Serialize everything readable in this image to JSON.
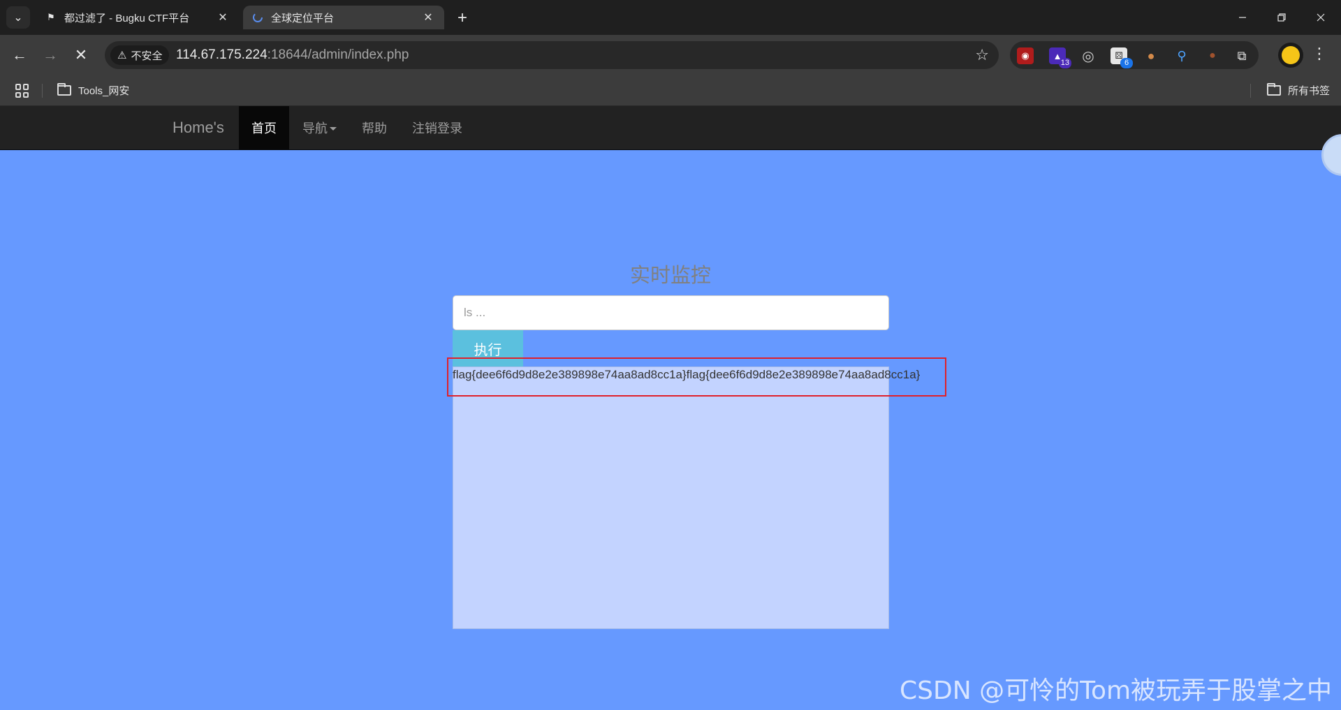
{
  "browser": {
    "tabs": [
      {
        "title": "都过滤了 - Bugku CTF平台",
        "favicon": "flag-icon",
        "active": false
      },
      {
        "title": "全球定位平台",
        "favicon": "loading-spinner-icon",
        "active": true
      }
    ],
    "address": {
      "security_label": "不安全",
      "url_host": "114.67.175.224",
      "url_rest": ":18644/admin/index.php"
    },
    "extensions": [
      {
        "name": "red-extension-icon",
        "badge": ""
      },
      {
        "name": "purple-hat-extension-icon",
        "badge": "13"
      },
      {
        "name": "circle-extension-icon",
        "badge": ""
      },
      {
        "name": "dice-extension-icon",
        "badge": "6"
      },
      {
        "name": "cookie-extension-icon",
        "badge": ""
      },
      {
        "name": "pin-extension-icon",
        "badge": ""
      },
      {
        "name": "bear-extension-icon",
        "badge": ""
      },
      {
        "name": "puzzle-extensions-icon",
        "badge": ""
      }
    ],
    "bookmarks": {
      "folder": "Tools_网安",
      "all_bookmarks": "所有书签"
    }
  },
  "site": {
    "brand": "Home's",
    "nav": [
      {
        "label": "首页",
        "active": true
      },
      {
        "label": "导航",
        "dropdown": true
      },
      {
        "label": "帮助"
      },
      {
        "label": "注销登录"
      }
    ],
    "panel": {
      "title": "实时监控",
      "input_placeholder": "ls ...",
      "input_value": "",
      "execute_label": "执行",
      "output": "flag{dee6f6d9d8e2e389898e74aa8ad8cc1a}flag{dee6f6d9d8e2e389898e74aa8ad8cc1a}"
    }
  },
  "watermark": "CSDN @可怜的Tom被玩弄于股掌之中",
  "colors": {
    "page_background": "#6699ff",
    "navbar": "#222222",
    "execute_button": "#5bc0de",
    "output_background": "#c3d3ff",
    "highlight_border": "#e0202a"
  }
}
